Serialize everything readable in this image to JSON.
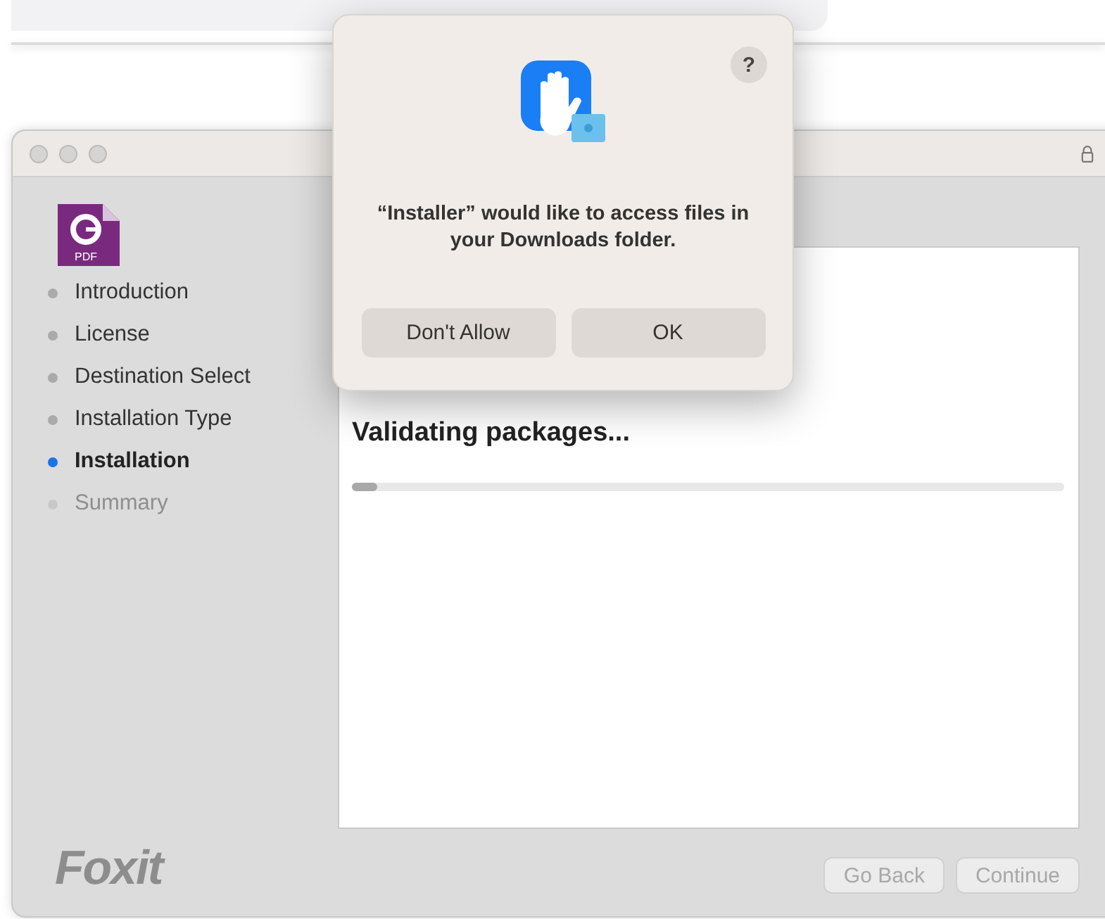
{
  "installer": {
    "steps": [
      {
        "label": "Introduction",
        "selected": false,
        "disabled": false
      },
      {
        "label": "License",
        "selected": false,
        "disabled": false
      },
      {
        "label": "Destination Select",
        "selected": false,
        "disabled": false
      },
      {
        "label": "Installation Type",
        "selected": false,
        "disabled": false
      },
      {
        "label": "Installation",
        "selected": true,
        "disabled": false
      },
      {
        "label": "Summary",
        "selected": false,
        "disabled": true
      }
    ],
    "app_icon_label": "PDF",
    "status_text": "Validating packages...",
    "progress": {
      "level": 0.035
    },
    "brand": "Foxit",
    "buttons": [
      {
        "label": "Go Back",
        "disabled": true
      },
      {
        "label": "Continue",
        "disabled": true
      }
    ]
  },
  "dialog": {
    "help": "?",
    "message": "“Installer” would like to access files in your Downloads folder.",
    "buttons": [
      {
        "label": "Don't Allow"
      },
      {
        "label": "OK"
      }
    ]
  }
}
